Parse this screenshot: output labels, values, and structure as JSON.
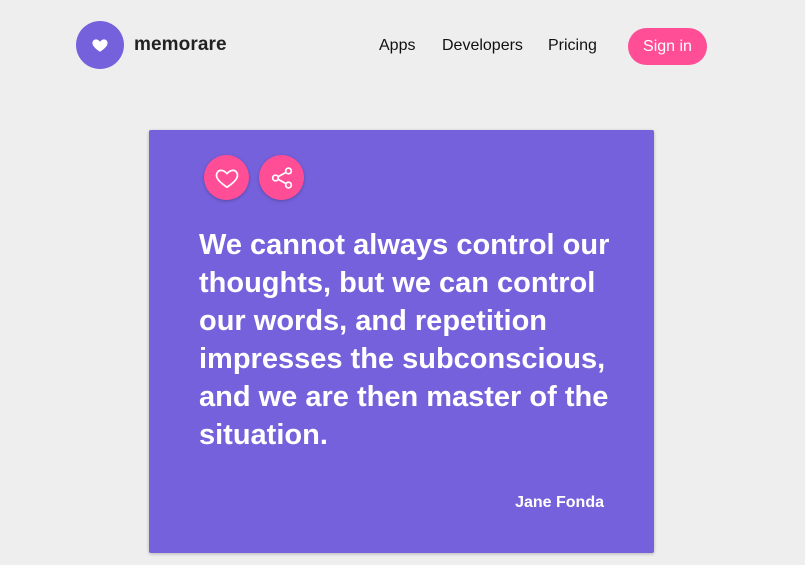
{
  "header": {
    "brand": "memorare",
    "logo_icon": "heart-icon",
    "nav": {
      "apps": "Apps",
      "developers": "Developers",
      "pricing": "Pricing"
    },
    "sign_in": "Sign in"
  },
  "quote_card": {
    "text": "We cannot always control our thoughts, but we can control our words, and repetition impresses the subconscious, and we are then master of the situation.",
    "author": "Jane Fonda",
    "like_icon": "heart-outline-icon",
    "share_icon": "share-icon"
  },
  "colors": {
    "background": "#eeeeee",
    "accent_purple": "#7561dc",
    "accent_pink": "#ff4d96",
    "text_dark": "#222222",
    "text_light": "#ffffff"
  }
}
